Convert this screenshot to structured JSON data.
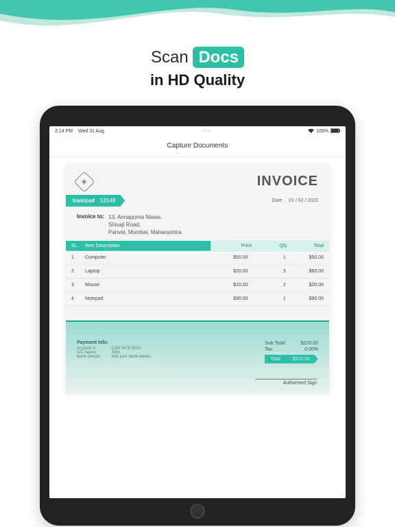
{
  "marketing": {
    "brand_prefix": "Scan",
    "brand_highlight": "Docs",
    "subline": "in HD Quality"
  },
  "statusbar": {
    "time": "2:14 PM",
    "date": "Wed 31 Aug",
    "battery": "100%"
  },
  "app": {
    "title": "Capture Documents"
  },
  "invoice": {
    "title": "INVOICE",
    "number_label": "Invoice#",
    "number": "53148",
    "date_label": "Date",
    "date": "01 / 02 / 2020",
    "to_label": "Invoice to:",
    "to_address_l1": "13, Annapurna Niwas,",
    "to_address_l2": "Shivaji Road,",
    "to_address_l3": "Panvel, Mumbai, Maharashtra",
    "columns": {
      "sl": "SL.",
      "desc": "Item Description",
      "price": "Price",
      "qty": "Qty.",
      "total": "Total"
    },
    "items": [
      {
        "sl": "1",
        "desc": "Computer",
        "price": "$50.00",
        "qty": "1",
        "total": "$50.00"
      },
      {
        "sl": "2",
        "desc": "Laptop",
        "price": "$20.00",
        "qty": "3",
        "total": "$60.00"
      },
      {
        "sl": "3",
        "desc": "Mouse",
        "price": "$10.00",
        "qty": "2",
        "total": "$20.00"
      },
      {
        "sl": "4",
        "desc": "Notepad",
        "price": "$90.00",
        "qty": "1",
        "total": "$90.00"
      }
    ],
    "payment": {
      "title": "Payment Info:",
      "account_k": "Account #:",
      "account_v": "1234 5678 9012",
      "name_k": "A/C Name:",
      "name_v": "John",
      "bank_k": "Bank Details:",
      "bank_v": "Add your bank details"
    },
    "summary": {
      "subtotal_k": "Sub Total:",
      "subtotal_v": "$220.00",
      "tax_k": "Tax:",
      "tax_v": "0.00%",
      "total_k": "Total:",
      "total_v": "$220.00"
    },
    "sign_label": "Authorised Sign"
  },
  "colors": {
    "accent": "#2dbfa6"
  }
}
